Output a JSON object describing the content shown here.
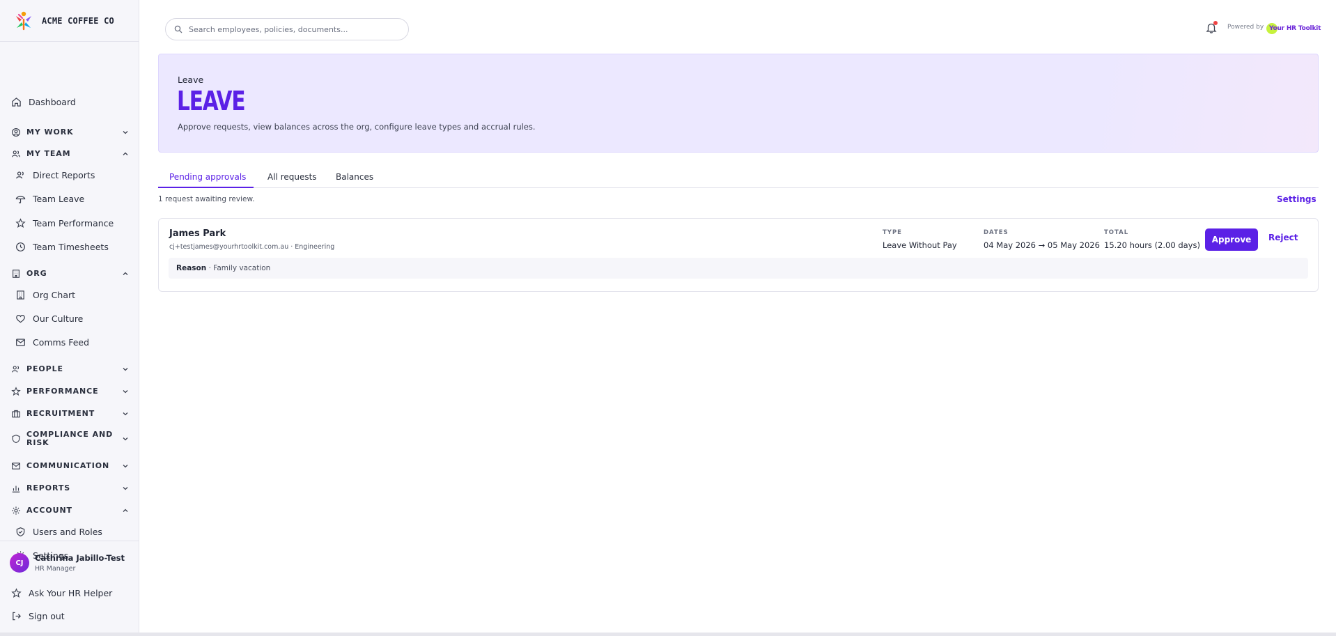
{
  "brand": {
    "name": "ACME COFFEE CO"
  },
  "sidebar": {
    "dashboard": "Dashboard",
    "sections": {
      "my_work": "MY WORK",
      "my_team": "MY TEAM",
      "org": "ORG",
      "people": "PEOPLE",
      "performance": "PERFORMANCE",
      "recruitment": "RECRUITMENT",
      "compliance": "COMPLIANCE AND RISK",
      "communication": "COMMUNICATION",
      "reports": "REPORTS",
      "account": "ACCOUNT"
    },
    "my_team_items": [
      "Direct Reports",
      "Team Leave",
      "Team Performance",
      "Team Timesheets"
    ],
    "org_items": [
      "Org Chart",
      "Our Culture",
      "Comms Feed"
    ],
    "account_items": [
      "Users and Roles",
      "Settings"
    ]
  },
  "user": {
    "initials": "CJ",
    "name": "Cathrina Jabillo-Test",
    "role": "HR Manager"
  },
  "footer": {
    "helper": "Ask Your HR Helper",
    "signout": "Sign out"
  },
  "search": {
    "placeholder": "Search employees, policies, documents..."
  },
  "topbar": {
    "powered_by": "Powered by",
    "partner_logo_text": "Your HR Toolkit"
  },
  "hero": {
    "eyebrow": "Leave",
    "title": "LEAVE",
    "description": "Approve requests, view balances across the org, configure leave types and accrual rules."
  },
  "tabs": [
    "Pending approvals",
    "All requests",
    "Balances"
  ],
  "active_tab": "Pending approvals",
  "status_text": "1 request awaiting review.",
  "settings_link": "Settings",
  "request": {
    "name": "James Park",
    "subtitle": "cj+testjames@yourhrtoolkit.com.au · Engineering",
    "type_label": "TYPE",
    "type_value": "Leave Without Pay",
    "dates_label": "DATES",
    "dates_value": "04 May 2026 → 05 May 2026",
    "total_label": "TOTAL",
    "total_value": "15.20 hours (2.00 days)",
    "reason_label": "Reason",
    "reason_value": " · Family vacation"
  },
  "actions": {
    "approve": "Approve",
    "reject": "Reject"
  },
  "colors": {
    "accent": "#5b21e6",
    "sidebar_bg": "#f6f6fa",
    "hero_bg": "#ece8ff",
    "notification": "#ef4444"
  }
}
